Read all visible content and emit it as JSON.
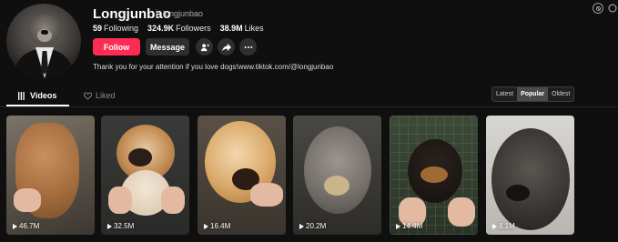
{
  "profile": {
    "name": "Longjunbao",
    "handle": "longjunbao",
    "stats": [
      {
        "value": "59",
        "label": "Following"
      },
      {
        "value": "324.9K",
        "label": "Followers"
      },
      {
        "value": "38.9M",
        "label": "Likes"
      }
    ],
    "bio": "Thank you for your attention if you love dogs!www.tiktok.com/@longjunbao"
  },
  "actions": {
    "follow_label": "Follow",
    "message_label": "Message",
    "icons": [
      "add-friend-icon",
      "share-icon",
      "more-icon"
    ]
  },
  "tabs": {
    "videos_label": "Videos",
    "liked_label": "Liked"
  },
  "sort": {
    "options": [
      "Latest",
      "Popular",
      "Oldest"
    ],
    "selected": "Popular"
  },
  "videos": [
    {
      "views": "46.7M"
    },
    {
      "views": "32.5M"
    },
    {
      "views": "16.4M"
    },
    {
      "views": "20.2M"
    },
    {
      "views": "14.4M"
    },
    {
      "views": "8.1M"
    }
  ],
  "colors": {
    "background": "#0f0f0f",
    "accent": "#fe2c55",
    "button_secondary": "#2f2f2f"
  }
}
